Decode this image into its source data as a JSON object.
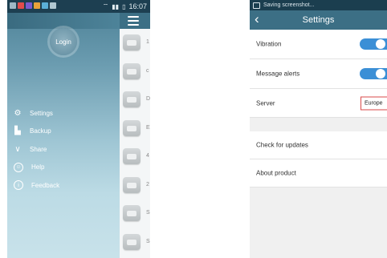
{
  "left_screen": {
    "status_bar": {
      "time": "16:07"
    },
    "login_label": "Login",
    "menu": [
      {
        "label": "Settings",
        "icon": "gear-icon"
      },
      {
        "label": "Backup",
        "icon": "backup-file-icon"
      },
      {
        "label": "Share",
        "icon": "share-icon"
      },
      {
        "label": "Help",
        "icon": "smiley-help-icon"
      },
      {
        "label": "Feedback",
        "icon": "info-circle-icon"
      }
    ],
    "list_rows": [
      {
        "letter": "1"
      },
      {
        "letter": "c"
      },
      {
        "letter": "D"
      },
      {
        "letter": "E"
      },
      {
        "letter": "4"
      },
      {
        "letter": "2"
      },
      {
        "letter": "S"
      },
      {
        "letter": "S"
      }
    ]
  },
  "right_screen": {
    "status_text": "Saving screenshot...",
    "title": "Settings",
    "rows": {
      "vibration": {
        "label": "Vibration",
        "enabled": true
      },
      "message_alerts": {
        "label": "Message alerts",
        "enabled": true
      },
      "server": {
        "label": "Server",
        "value": "Europe"
      },
      "check_updates": {
        "label": "Check for updates"
      },
      "about": {
        "label": "About product"
      }
    }
  },
  "colors": {
    "header": "#3c6f85",
    "toggle_on": "#3b8fd6",
    "highlight_border": "#d94a4a"
  }
}
